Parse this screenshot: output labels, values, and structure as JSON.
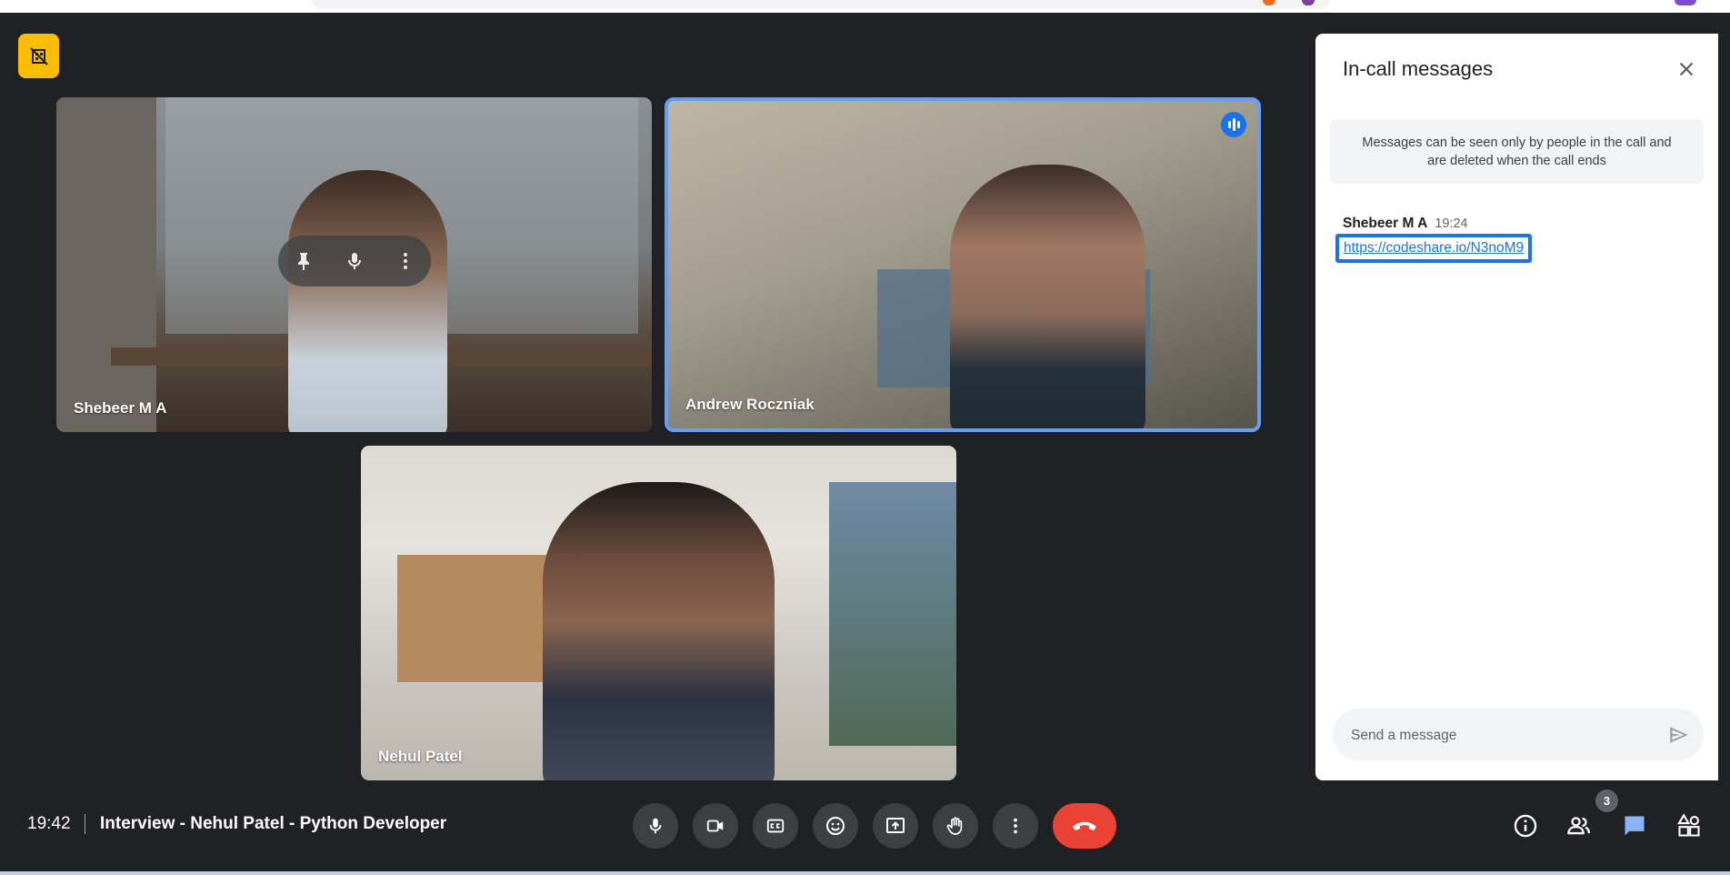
{
  "meeting": {
    "time": "19:42",
    "title": "Interview - Nehul Patel - Python Developer"
  },
  "participants": [
    {
      "name": "Shebeer M A"
    },
    {
      "name": "Andrew Roczniak",
      "speaking": true
    },
    {
      "name": "Nehul Patel"
    }
  ],
  "participant_count": "3",
  "chat": {
    "title": "In-call messages",
    "notice": "Messages can be seen only by people in the call and are deleted when the call ends",
    "messages": [
      {
        "sender": "Shebeer M A",
        "time": "19:24",
        "text": "https://codeshare.io/N3noM9"
      }
    ],
    "input_placeholder": "Send a message"
  },
  "colors": {
    "background": "#202124",
    "accent": "#1a73e8",
    "end_call": "#ea4335",
    "badge_yellow": "#fbbc04"
  },
  "icons": {
    "tile_hover": [
      "pin-icon",
      "mic-icon",
      "more-vert-icon"
    ],
    "controls": [
      "mic-icon",
      "camera-icon",
      "captions-icon",
      "emoji-icon",
      "present-icon",
      "raise-hand-icon",
      "more-vert-icon",
      "end-call-icon"
    ],
    "right_controls": [
      "info-icon",
      "people-icon",
      "chat-icon",
      "activities-icon"
    ]
  }
}
